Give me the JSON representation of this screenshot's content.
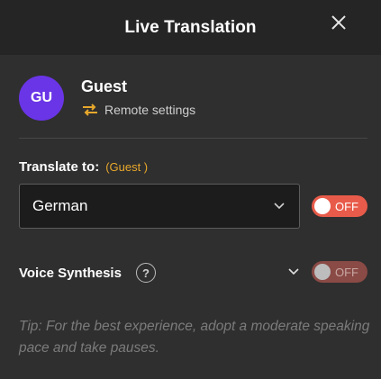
{
  "header": {
    "title": "Live Translation",
    "close_icon": "close-icon"
  },
  "user": {
    "initials": "GU",
    "name": "Guest",
    "avatar_color": "#6a35e6",
    "remote_settings_label": "Remote settings",
    "remote_icon": "swap-arrows-icon",
    "remote_icon_color": "#e8a82b"
  },
  "translate": {
    "label": "Translate to:",
    "who": "(Guest )",
    "selected_language": "German",
    "toggle_label": "OFF",
    "toggle_color": "#e85b4a"
  },
  "voice": {
    "label": "Voice Synthesis",
    "help_glyph": "?",
    "toggle_label": "OFF",
    "toggle_enabled": false
  },
  "tip": "Tip: For the best experience, adopt a moderate speaking pace and take pauses."
}
